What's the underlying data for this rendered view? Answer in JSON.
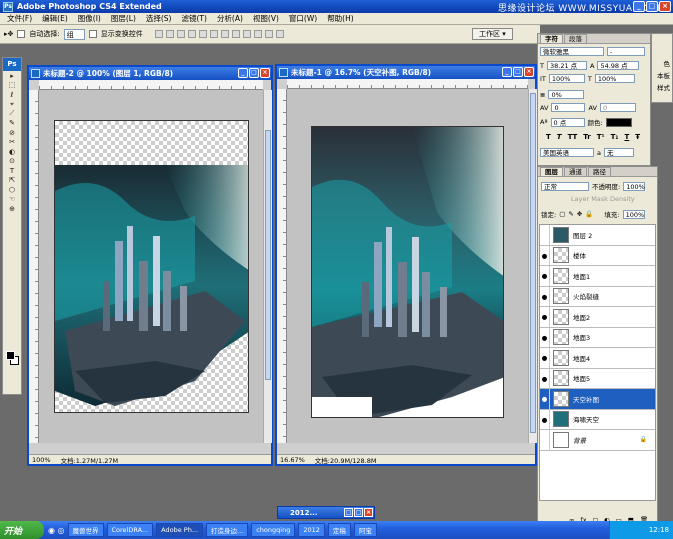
{
  "app": {
    "title": "Adobe Photoshop CS4 Extended",
    "watermark": "思缘设计论坛 WWW.MISSYUAN.COM",
    "ps_label": "Ps",
    "win_min": "_",
    "win_max": "□",
    "win_close": "×"
  },
  "menu": [
    "文件(F)",
    "编辑(E)",
    "图像(I)",
    "图层(L)",
    "选择(S)",
    "滤镜(T)",
    "分析(A)",
    "视图(V)",
    "窗口(W)",
    "帮助(H)"
  ],
  "options": {
    "auto_select_label": "自动选择:",
    "auto_select_value": "组",
    "show_transform_label": "显示变换控件",
    "workspace_label": "工作区 ▾"
  },
  "tools": [
    "▸",
    "⬚",
    "ℓ",
    "⌖",
    "⟋",
    "✎",
    "⊘",
    "✂",
    "◐",
    "⊙",
    "T",
    "⇱",
    "⬡",
    "☜",
    "⊕"
  ],
  "doc1": {
    "title": "未标题-2 @ 100% (图层 1, RGB/8)",
    "zoom": "100%",
    "file_info": "文档:1.27M/1.27M"
  },
  "doc2": {
    "title": "未标题-1 @ 16.7% (天空补图, RGB/8)",
    "zoom": "16.67%",
    "file_info": "文档:20.9M/128.8M"
  },
  "character": {
    "tab_char": "字符",
    "tab_para": "段落",
    "font_family": "微软雅黑",
    "font_style": "-",
    "font_size": "38.21 点",
    "leading": "54.98 点",
    "scale_v": "100%",
    "scale_h": "100%",
    "tracking_rel": "0%",
    "kerning": "0",
    "tracking": "0",
    "baseline": "0 点",
    "color_label": "颜色:",
    "format_buttons": [
      "T",
      "T",
      "TT",
      "Tr",
      "T¹",
      "T₁",
      "T",
      "Ŧ"
    ],
    "language": "美国英语",
    "aa_label": "a",
    "aa_value": "无"
  },
  "side_strip": [
    "色",
    "本板",
    "样式"
  ],
  "layers": {
    "tabs": [
      "图层",
      "通道",
      "路径"
    ],
    "blend_mode": "正常",
    "opacity_label": "不透明度:",
    "opacity_value": "100%",
    "mask_density": "Layer Mask Density",
    "lock_label": "锁定:",
    "fill_label": "填充:",
    "fill_value": "100%",
    "items": [
      {
        "name": "图层 2",
        "visible": false,
        "selected": false
      },
      {
        "name": "楼体",
        "visible": true,
        "selected": false
      },
      {
        "name": "地面1",
        "visible": true,
        "selected": false
      },
      {
        "name": "火焰裂缝",
        "visible": true,
        "selected": false
      },
      {
        "name": "地面2",
        "visible": true,
        "selected": false
      },
      {
        "name": "地面3",
        "visible": true,
        "selected": false
      },
      {
        "name": "地面4",
        "visible": true,
        "selected": false
      },
      {
        "name": "地面5",
        "visible": true,
        "selected": false
      },
      {
        "name": "天空补图",
        "visible": true,
        "selected": true
      },
      {
        "name": "海啸天空",
        "visible": true,
        "selected": false
      },
      {
        "name": "背景",
        "visible": false,
        "selected": false,
        "locked": true
      }
    ],
    "bottom_icons": [
      "∞",
      "fx",
      "◻",
      "◐",
      "▭",
      "⬒",
      "🗑"
    ]
  },
  "minimized_doc": {
    "title": "2012..."
  },
  "taskbar": {
    "start": "开始",
    "buttons": [
      "魔兽世界",
      "CorelDRA...",
      "Adobe Ph...",
      "打造身边...",
      "chongqing",
      "2012",
      "定稿",
      "阿宝"
    ],
    "clock": "12:18"
  }
}
